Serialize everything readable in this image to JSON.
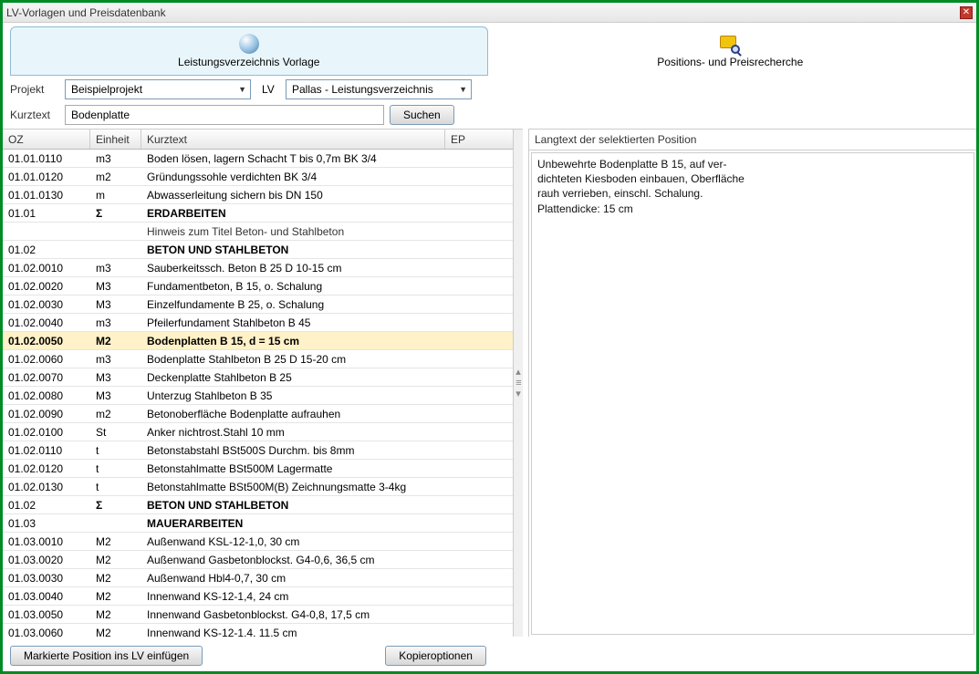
{
  "window": {
    "title": "LV-Vorlagen und Preisdatenbank"
  },
  "tabs": {
    "template": "Leistungsverzeichnis Vorlage",
    "research": "Positions- und Preisrecherche"
  },
  "filters": {
    "projekt_label": "Projekt",
    "projekt_value": "Beispielprojekt",
    "lv_label": "LV",
    "lv_value": "Pallas - Leistungsverzeichnis",
    "kurztext_label": "Kurztext",
    "kurztext_value": "Bodenplatte",
    "search_btn": "Suchen"
  },
  "table": {
    "headers": {
      "oz": "OZ",
      "einheit": "Einheit",
      "kurztext": "Kurztext",
      "ep": "EP"
    },
    "rows": [
      {
        "oz": "01.01.0110",
        "ein": "m3",
        "kurz": "Boden lösen, lagern Schacht T bis 0,7m BK 3/4",
        "style": ""
      },
      {
        "oz": "01.01.0120",
        "ein": "m2",
        "kurz": "Gründungssohle verdichten BK 3/4",
        "style": ""
      },
      {
        "oz": "01.01.0130",
        "ein": "m",
        "kurz": "Abwasserleitung sichern bis DN 150",
        "style": ""
      },
      {
        "oz": "01.01",
        "ein": "Σ",
        "kurz": "ERDARBEITEN",
        "style": "bold"
      },
      {
        "oz": "",
        "ein": "",
        "kurz": "Hinweis zum Titel Beton- und Stahlbeton",
        "style": "note"
      },
      {
        "oz": "01.02",
        "ein": "",
        "kurz": "BETON UND STAHLBETON",
        "style": "bold"
      },
      {
        "oz": "01.02.0010",
        "ein": "m3",
        "kurz": "Sauberkeitssch. Beton B 25 D 10-15 cm",
        "style": ""
      },
      {
        "oz": "01.02.0020",
        "ein": "M3",
        "kurz": "Fundamentbeton, B 15, o. Schalung",
        "style": ""
      },
      {
        "oz": "01.02.0030",
        "ein": "M3",
        "kurz": "Einzelfundamente B 25, o. Schalung",
        "style": ""
      },
      {
        "oz": "01.02.0040",
        "ein": "m3",
        "kurz": "Pfeilerfundament Stahlbeton B 45",
        "style": ""
      },
      {
        "oz": "01.02.0050",
        "ein": "M2",
        "kurz": "Bodenplatten B 15, d = 15 cm",
        "style": "highlight"
      },
      {
        "oz": "01.02.0060",
        "ein": "m3",
        "kurz": "Bodenplatte Stahlbeton B 25 D 15-20 cm",
        "style": ""
      },
      {
        "oz": "01.02.0070",
        "ein": "M3",
        "kurz": "Deckenplatte Stahlbeton B 25",
        "style": ""
      },
      {
        "oz": "01.02.0080",
        "ein": "M3",
        "kurz": "Unterzug Stahlbeton B 35",
        "style": ""
      },
      {
        "oz": "01.02.0090",
        "ein": "m2",
        "kurz": "Betonoberfläche Bodenplatte aufrauhen",
        "style": ""
      },
      {
        "oz": "01.02.0100",
        "ein": "St",
        "kurz": "Anker nichtrost.Stahl 10 mm",
        "style": ""
      },
      {
        "oz": "01.02.0110",
        "ein": "t",
        "kurz": "Betonstabstahl BSt500S Durchm. bis 8mm",
        "style": ""
      },
      {
        "oz": "01.02.0120",
        "ein": "t",
        "kurz": "Betonstahlmatte BSt500M Lagermatte",
        "style": ""
      },
      {
        "oz": "01.02.0130",
        "ein": "t",
        "kurz": "Betonstahlmatte BSt500M(B) Zeichnungsmatte 3-4kg",
        "style": ""
      },
      {
        "oz": "01.02",
        "ein": "Σ",
        "kurz": "BETON UND STAHLBETON",
        "style": "bold"
      },
      {
        "oz": "01.03",
        "ein": "",
        "kurz": "MAUERARBEITEN",
        "style": "bold"
      },
      {
        "oz": "01.03.0010",
        "ein": "M2",
        "kurz": "Außenwand KSL-12-1,0, 30 cm",
        "style": ""
      },
      {
        "oz": "01.03.0020",
        "ein": "M2",
        "kurz": "Außenwand Gasbetonblockst. G4-0,6, 36,5 cm",
        "style": ""
      },
      {
        "oz": "01.03.0030",
        "ein": "M2",
        "kurz": "Außenwand Hbl4-0,7, 30 cm",
        "style": ""
      },
      {
        "oz": "01.03.0040",
        "ein": "M2",
        "kurz": "Innenwand KS-12-1,4, 24 cm",
        "style": ""
      },
      {
        "oz": "01.03.0050",
        "ein": "M2",
        "kurz": "Innenwand Gasbetonblockst. G4-0,8, 17,5 cm",
        "style": ""
      },
      {
        "oz": "01.03.0060",
        "ein": "M2",
        "kurz": "Innenwand KS-12-1,4, 11,5 cm",
        "style": ""
      }
    ]
  },
  "detail": {
    "header": "Langtext der selektierten Position",
    "body": "Unbewehrte Bodenplatte B 15, auf ver-\ndichteten Kiesboden einbauen, Oberfläche\nrauh verrieben, einschl. Schalung.\nPlattendicke: 15 cm"
  },
  "buttons": {
    "insert": "Markierte Position ins LV einfügen",
    "copy": "Kopieroptionen"
  }
}
